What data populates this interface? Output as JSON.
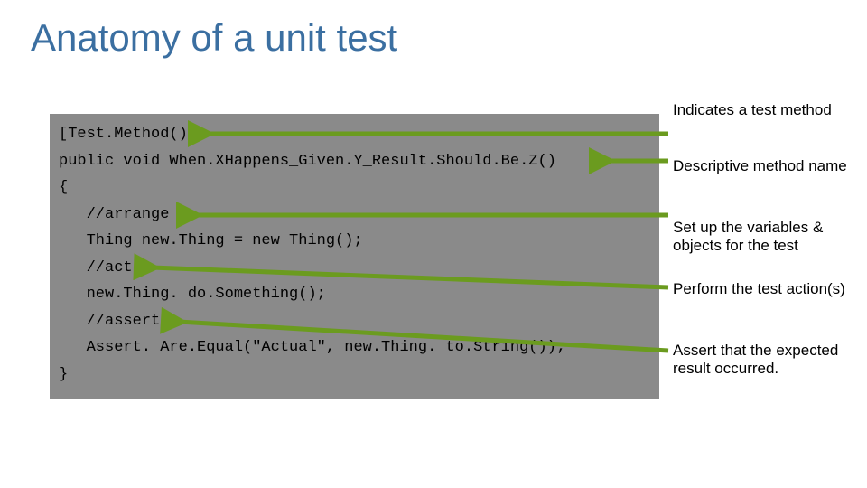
{
  "title": "Anatomy of a unit test",
  "code": {
    "l1": "[Test.Method()]",
    "l2": "public void When.XHappens_Given.Y_Result.Should.Be.Z()",
    "l3": "{",
    "l4": "   //arrange",
    "l5": "   Thing new.Thing = new Thing();",
    "l6": "   //act",
    "l7": "   new.Thing. do.Something();",
    "l8": "   //assert",
    "l9": "   Assert. Are.Equal(\"Actual\", new.Thing. to.String());",
    "l10": "}"
  },
  "annotations": {
    "a1": "Indicates a test method",
    "a2": "Descriptive method name",
    "a3": "Set up the variables & objects for the test",
    "a4": "Perform the test action(s)",
    "a5": "Assert that the expected result occurred."
  },
  "colors": {
    "title": "#3b6fa1",
    "code_bg": "#8a8a8a",
    "arrow": "#6b9b1f"
  }
}
